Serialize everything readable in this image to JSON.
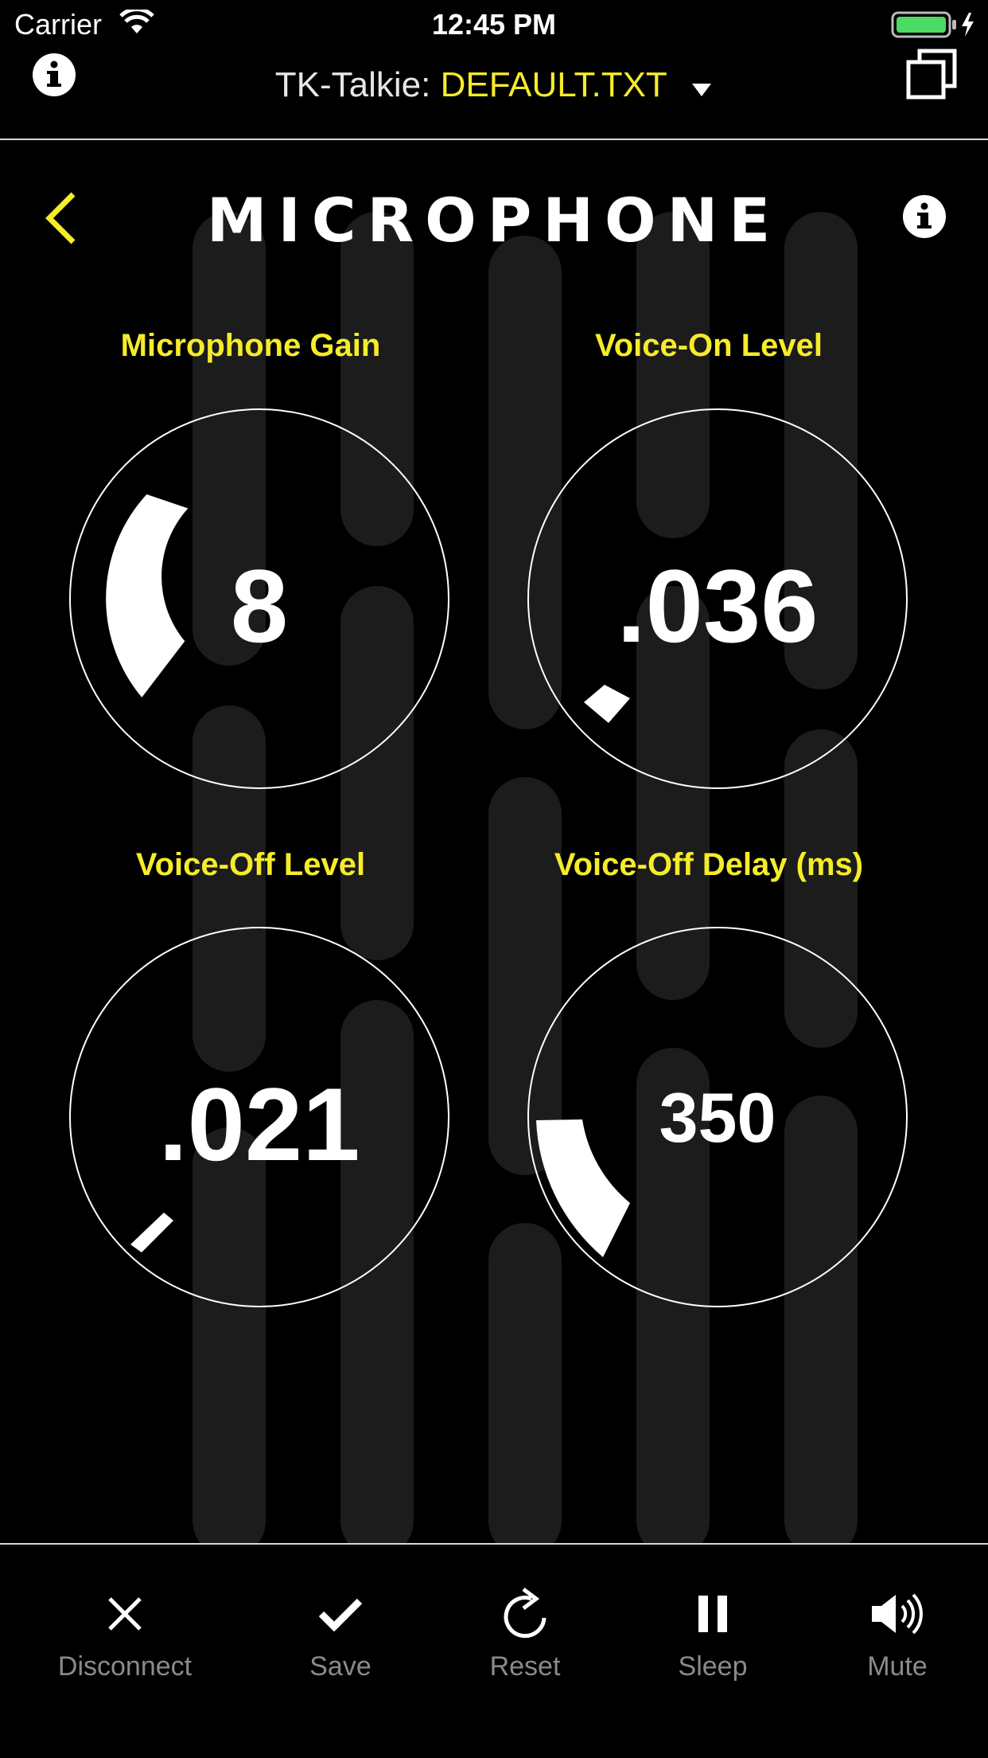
{
  "status_bar": {
    "carrier": "Carrier",
    "time": "12:45 PM",
    "battery_color": "#4cd964"
  },
  "nav": {
    "app_name": "TK-Talkie:",
    "file_name": "DEFAULT.TXT",
    "accent": "#f5ec2a"
  },
  "page": {
    "title": "MICROPHONE"
  },
  "knobs": [
    {
      "label": "Microphone Gain",
      "value": "8",
      "level": 0.32
    },
    {
      "label": "Voice-On Level",
      "value": ".036",
      "level": 0.04
    },
    {
      "label": "Voice-Off Level",
      "value": ".021",
      "level": 0.03
    },
    {
      "label": "Voice-Off Delay (ms)",
      "value": "350",
      "level": 0.2
    }
  ],
  "toolbar": {
    "disconnect": "Disconnect",
    "save": "Save",
    "reset": "Reset",
    "sleep": "Sleep",
    "mute": "Mute"
  }
}
